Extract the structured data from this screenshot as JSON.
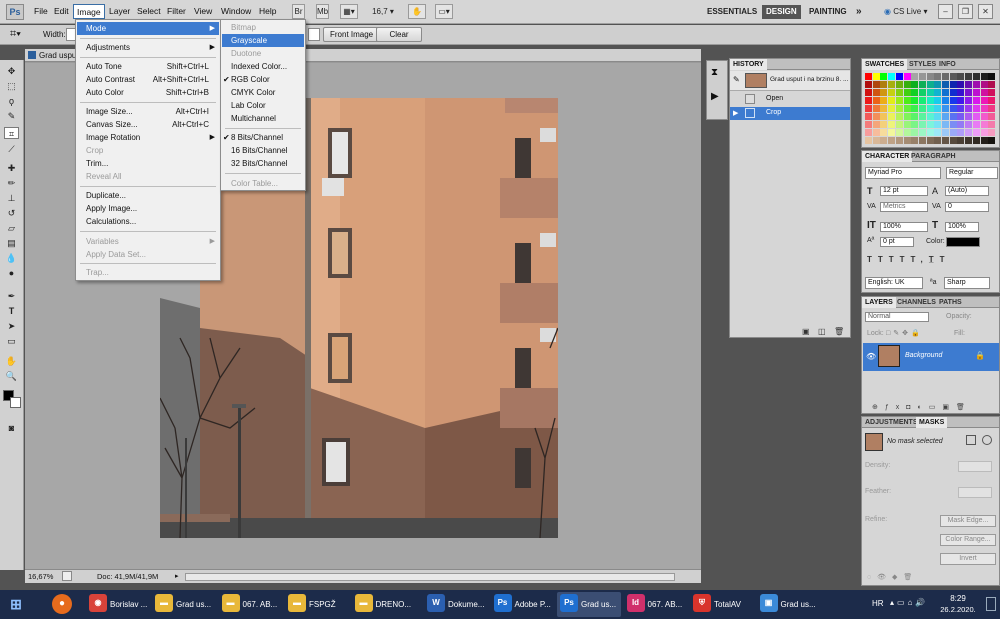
{
  "menubar": {
    "logo": "Ps",
    "items": [
      "File",
      "Edit",
      "Image",
      "Layer",
      "Select",
      "Filter",
      "View",
      "Window",
      "Help"
    ],
    "active": "Image",
    "zoom": "16,7",
    "workspaces": [
      "ESSENTIALS",
      "DESIGN",
      "PAINTING"
    ],
    "active_workspace": "DESIGN",
    "more": "»",
    "cs_live": "CS Live"
  },
  "optionsbar": {
    "width_label": "Width:",
    "front_image": "Front Image",
    "clear": "Clear"
  },
  "image_menu": {
    "items": [
      {
        "label": "Mode",
        "submenu": true,
        "highlight": true
      },
      {
        "label": "Adjustments",
        "submenu": true
      },
      {
        "label": "Auto Tone",
        "shortcut": "Shift+Ctrl+L"
      },
      {
        "label": "Auto Contrast",
        "shortcut": "Alt+Shift+Ctrl+L"
      },
      {
        "label": "Auto Color",
        "shortcut": "Shift+Ctrl+B"
      },
      {
        "label": "Image Size...",
        "shortcut": "Alt+Ctrl+I"
      },
      {
        "label": "Canvas Size...",
        "shortcut": "Alt+Ctrl+C"
      },
      {
        "label": "Image Rotation",
        "submenu": true
      },
      {
        "label": "Crop",
        "disabled": true
      },
      {
        "label": "Trim..."
      },
      {
        "label": "Reveal All",
        "disabled": true
      },
      {
        "label": "Duplicate..."
      },
      {
        "label": "Apply Image..."
      },
      {
        "label": "Calculations..."
      },
      {
        "label": "Variables",
        "submenu": true,
        "disabled": true
      },
      {
        "label": "Apply Data Set...",
        "disabled": true
      },
      {
        "label": "Trap...",
        "disabled": true
      }
    ]
  },
  "mode_menu": {
    "items": [
      {
        "label": "Bitmap",
        "disabled": true
      },
      {
        "label": "Grayscale",
        "highlight": true
      },
      {
        "label": "Duotone",
        "disabled": true
      },
      {
        "label": "Indexed Color..."
      },
      {
        "label": "RGB Color",
        "checked": true
      },
      {
        "label": "CMYK Color"
      },
      {
        "label": "Lab Color"
      },
      {
        "label": "Multichannel"
      },
      {
        "label": "8 Bits/Channel",
        "checked": true
      },
      {
        "label": "16 Bits/Channel"
      },
      {
        "label": "32 Bits/Channel"
      },
      {
        "label": "Color Table...",
        "disabled": true
      }
    ]
  },
  "document": {
    "title": "Grad usput",
    "zoom": "16,67%",
    "doc_size": "Doc: 41,9M/41,9M"
  },
  "history": {
    "tab": "HISTORY",
    "snapshot": "Grad usput i na brzinu 8. ...",
    "steps": [
      "Open",
      "Crop"
    ],
    "active_step": "Crop"
  },
  "swatches_panel": {
    "tabs": [
      "SWATCHES",
      "STYLES",
      "INFO"
    ]
  },
  "character_panel": {
    "tabs": [
      "CHARACTER",
      "PARAGRAPH"
    ],
    "font_family": "Myriad Pro",
    "font_style": "Regular",
    "font_size": "12 pt",
    "leading": "(Auto)",
    "kerning": "Metrics",
    "tracking": "0",
    "vertical_scale": "100%",
    "horizontal_scale": "100%",
    "baseline": "0 pt",
    "color_label": "Color:",
    "language": "English: UK",
    "antialias": "Sharp"
  },
  "layers_panel": {
    "tabs": [
      "LAYERS",
      "CHANNELS",
      "PATHS"
    ],
    "blend_mode": "Normal",
    "opacity_label": "Opacity:",
    "lock_label": "Lock:",
    "fill_label": "Fill:",
    "layer_name": "Background"
  },
  "adjustments_panel": {
    "tabs": [
      "ADJUSTMENTS",
      "MASKS"
    ],
    "status": "No mask selected",
    "density_label": "Density:",
    "feather_label": "Feather:",
    "refine_label": "Refine:",
    "mask_edge": "Mask Edge...",
    "color_range": "Color Range...",
    "invert": "Invert"
  },
  "taskbar": {
    "apps": [
      {
        "label": "Borislav ...",
        "icon": "chrome-icon"
      },
      {
        "label": "Grad us...",
        "icon": "folder-icon"
      },
      {
        "label": "067. AB...",
        "icon": "folder-icon"
      },
      {
        "label": "FSPGŽ",
        "icon": "folder-icon"
      },
      {
        "label": "DRENO...",
        "icon": "folder-icon"
      },
      {
        "label": "Dokume...",
        "icon": "word-icon"
      },
      {
        "label": "Adobe P...",
        "icon": "photoshop-icon"
      },
      {
        "label": "Grad us...",
        "icon": "photoshop-icon",
        "active": true
      },
      {
        "label": "067. AB...",
        "icon": "indesign-icon"
      },
      {
        "label": "TotalAV",
        "icon": "totalav-icon"
      },
      {
        "label": "Grad us...",
        "icon": "photos-icon"
      }
    ],
    "language": "HR",
    "time": "8:29",
    "date": "26.2.2020."
  }
}
